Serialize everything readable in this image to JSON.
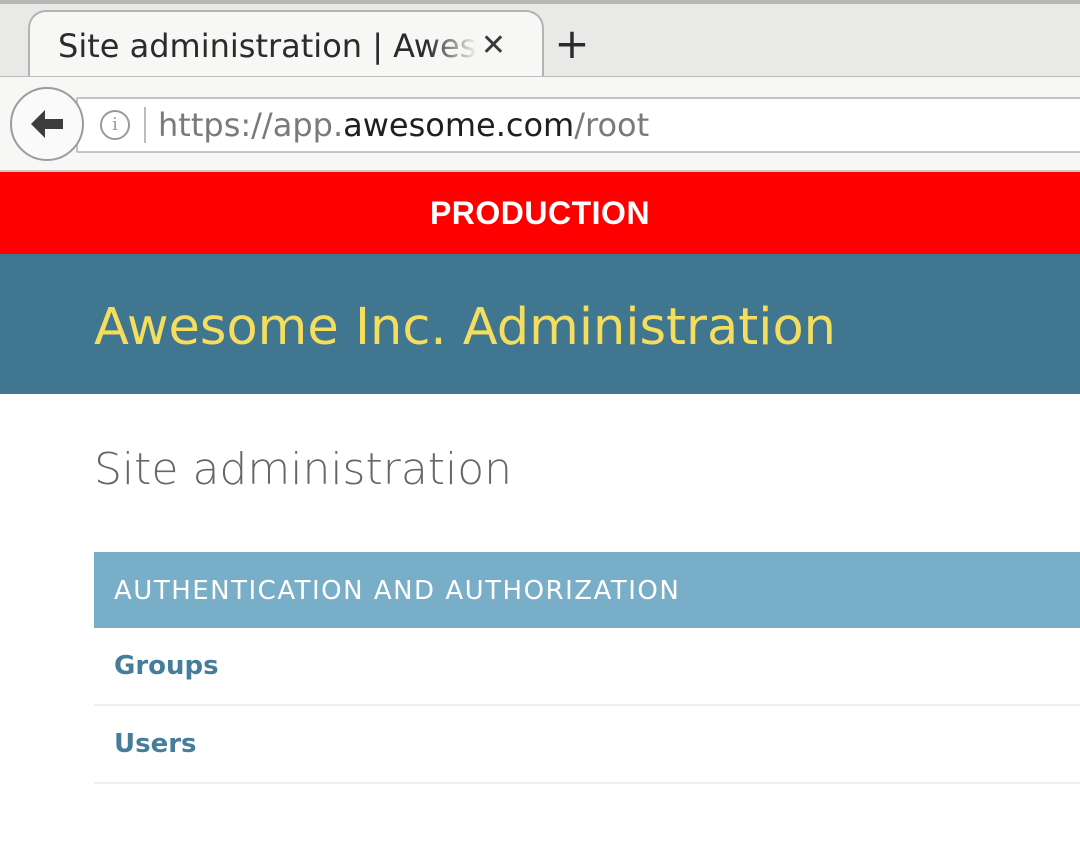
{
  "browser": {
    "tab_title": "Site administration | Awesome Inc. Administration",
    "tab_close_icon": "close-icon",
    "new_tab_icon": "plus-icon",
    "back_icon": "arrow-left-icon",
    "info_icon": "info-icon",
    "url": {
      "scheme": "https://",
      "subdomain": "app.",
      "host": "awesome.com",
      "path": "/root"
    }
  },
  "banner": {
    "label": "PRODUCTION",
    "color": "#ff0000"
  },
  "site_header": {
    "title": "Awesome Inc. Administration",
    "background": "#417690",
    "title_color": "#f5dd5d"
  },
  "content": {
    "page_title": "Site administration",
    "modules": [
      {
        "caption": "AUTHENTICATION AND AUTHORIZATION",
        "caption_color": "#79aec8",
        "models": [
          {
            "label": "Groups"
          },
          {
            "label": "Users"
          }
        ]
      }
    ]
  }
}
